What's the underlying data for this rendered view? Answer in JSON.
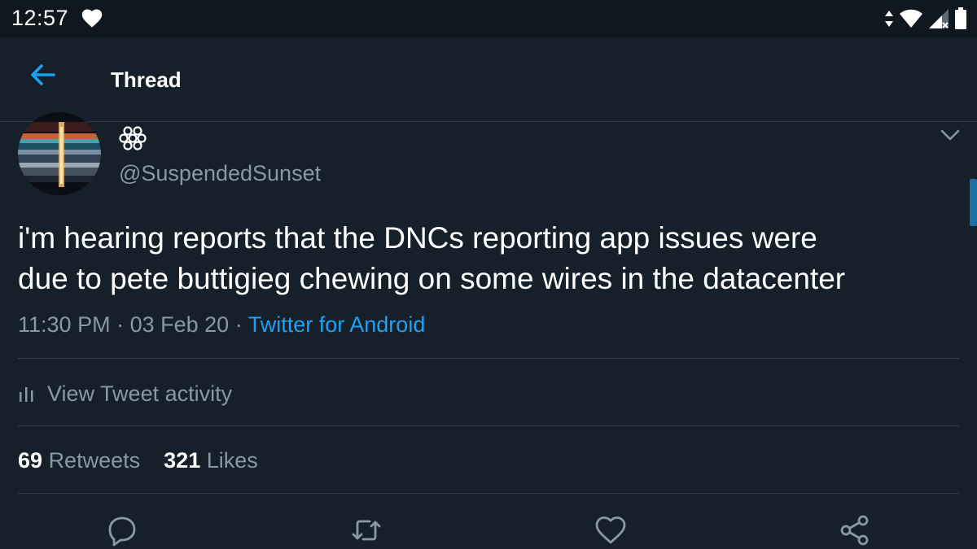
{
  "status_bar": {
    "time": "12:57"
  },
  "header": {
    "title": "Thread"
  },
  "tweet": {
    "handle": "@SuspendedSunset",
    "text_line1": "i'm hearing reports that the DNCs reporting app issues were",
    "text_line2": "due to pete buttigieg chewing on some wires in the datacenter",
    "time": "11:30 PM",
    "separator": "·",
    "date": "03 Feb 20",
    "source": "Twitter for Android",
    "activity_label": "View Tweet activity",
    "retweets_count": "69",
    "retweets_label": "Retweets",
    "likes_count": "321",
    "likes_label": "Likes"
  },
  "colors": {
    "background": "#15202b",
    "accent": "#1da1f2",
    "secondary_text": "#8899a6",
    "divider": "#2f3c4a"
  }
}
